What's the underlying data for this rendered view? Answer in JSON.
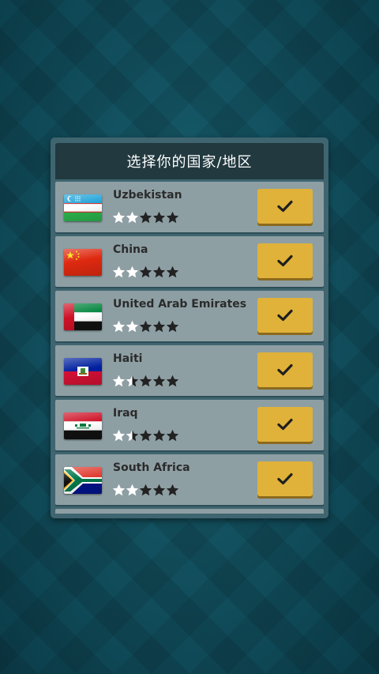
{
  "header": {
    "title": "选择你的国家/地区"
  },
  "countries": [
    {
      "name": "Uzbekistan",
      "flag": "uzbekistan-flag",
      "rating": 2
    },
    {
      "name": "China",
      "flag": "china-flag",
      "rating": 2
    },
    {
      "name": "United Arab Emirates",
      "flag": "uae-flag",
      "rating": 2
    },
    {
      "name": "Haiti",
      "flag": "haiti-flag",
      "rating": 1.5
    },
    {
      "name": "Iraq",
      "flag": "iraq-flag",
      "rating": 1.5
    },
    {
      "name": "South Africa",
      "flag": "south-africa-flag",
      "rating": 2
    }
  ],
  "max_rating": 5,
  "icons": {
    "select": "check-icon",
    "star": "star-icon"
  },
  "colors": {
    "background": "#0f4b5a",
    "panel": "#3f6570",
    "header": "#21393f",
    "row": "#8e9fa4",
    "button": "#e0b23a",
    "star_filled": "#ffffff",
    "star_empty": "#222222"
  }
}
